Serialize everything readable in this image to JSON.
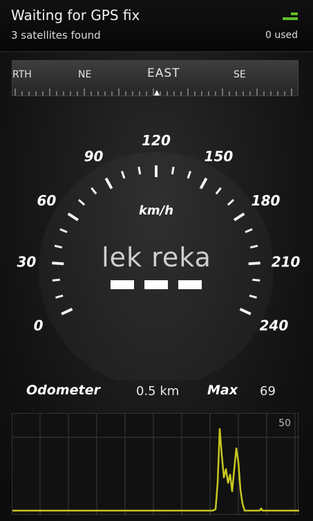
{
  "status": {
    "title": "Waiting for GPS fix",
    "subtitle": "3 satellites found",
    "used": "0 used",
    "icon": "satellite-signal-icon",
    "accent": "#5fbf2a"
  },
  "compass": {
    "labels": [
      "RTH",
      "NE",
      "EAST",
      "SE"
    ],
    "heading": "EAST"
  },
  "speedometer": {
    "unit": "km/h",
    "ticks": [
      "0",
      "30",
      "60",
      "90",
      "120",
      "150",
      "180",
      "210",
      "240"
    ],
    "readout": "lek reka",
    "min": 0,
    "max": 240
  },
  "odometer": {
    "label": "Odometer",
    "value": "0.5 km",
    "max_label": "Max",
    "max_value": "69"
  },
  "graph": {
    "scale_label": "50",
    "line_color": "#c8c820"
  }
}
